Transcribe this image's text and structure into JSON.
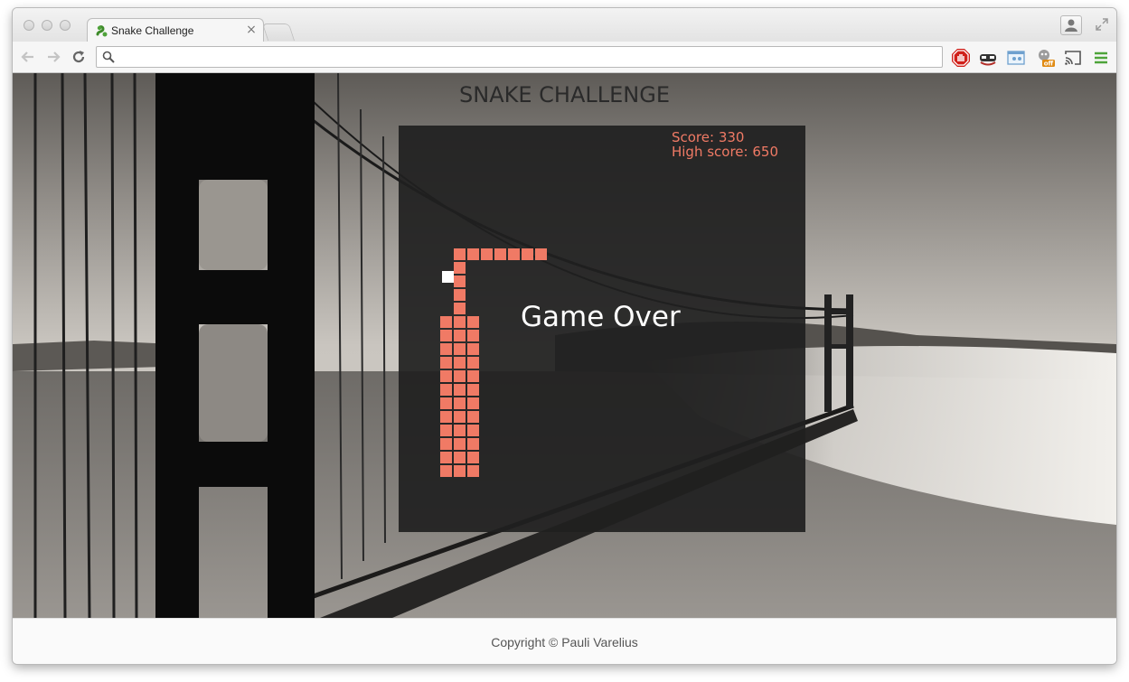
{
  "browser": {
    "tab_title": "Snake Challenge",
    "tab_close": "×",
    "address_placeholder": "",
    "address_value": ""
  },
  "page": {
    "title": "SNAKE CHALLENGE",
    "footer": "Copyright © Pauli Varelius"
  },
  "game": {
    "score_text": "Score: 330",
    "high_score_text": "High score: 650",
    "status": "Game Over",
    "score": 330,
    "high_score": 650,
    "grid_size": 30,
    "snake_cells": [
      [
        4,
        9
      ],
      [
        4,
        10
      ],
      [
        4,
        11
      ],
      [
        4,
        12
      ],
      [
        4,
        13
      ],
      [
        4,
        14
      ],
      [
        4,
        15
      ],
      [
        4,
        16
      ],
      [
        4,
        17
      ],
      [
        4,
        18
      ],
      [
        4,
        19
      ],
      [
        4,
        20
      ],
      [
        4,
        21
      ],
      [
        4,
        22
      ],
      [
        4,
        23
      ],
      [
        4,
        24
      ],
      [
        4,
        25
      ],
      [
        3,
        14
      ],
      [
        3,
        15
      ],
      [
        3,
        16
      ],
      [
        3,
        17
      ],
      [
        3,
        18
      ],
      [
        3,
        19
      ],
      [
        3,
        20
      ],
      [
        3,
        21
      ],
      [
        3,
        22
      ],
      [
        3,
        23
      ],
      [
        3,
        24
      ],
      [
        3,
        25
      ],
      [
        5,
        9
      ],
      [
        6,
        9
      ],
      [
        7,
        9
      ],
      [
        8,
        9
      ],
      [
        9,
        9
      ],
      [
        10,
        9
      ],
      [
        5,
        14
      ],
      [
        5,
        15
      ],
      [
        5,
        16
      ],
      [
        5,
        17
      ],
      [
        5,
        18
      ],
      [
        5,
        19
      ],
      [
        5,
        20
      ],
      [
        5,
        21
      ],
      [
        5,
        22
      ],
      [
        5,
        23
      ],
      [
        5,
        24
      ],
      [
        5,
        25
      ]
    ],
    "food_cell": [
      4,
      11
    ],
    "colors": {
      "snake": "#f07a65",
      "food": "#ffffff",
      "board": "#202020",
      "score_text": "#f07a65"
    }
  }
}
